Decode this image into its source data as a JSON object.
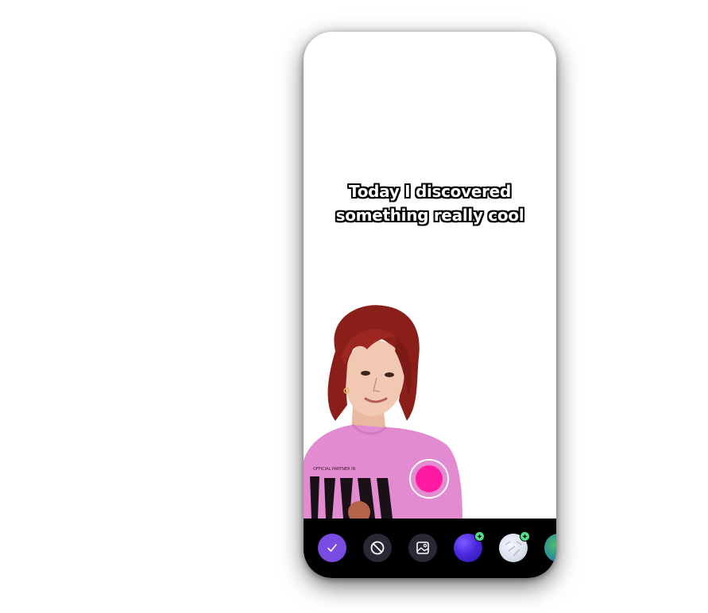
{
  "caption": {
    "line1": "Today I discovered",
    "line2": "something really cool"
  },
  "colors": {
    "record": "#ff1aa3",
    "confirm": "#7a4be0",
    "toolbar": "#000000",
    "badge": "#4fe08a"
  },
  "toolbar": {
    "items": [
      {
        "icon": "check-icon"
      },
      {
        "icon": "no-background-icon"
      },
      {
        "icon": "image-background-icon"
      },
      {
        "icon": "purple-gradient-background-icon"
      },
      {
        "icon": "light-texture-background-icon"
      },
      {
        "icon": "earth-background-icon"
      }
    ]
  }
}
